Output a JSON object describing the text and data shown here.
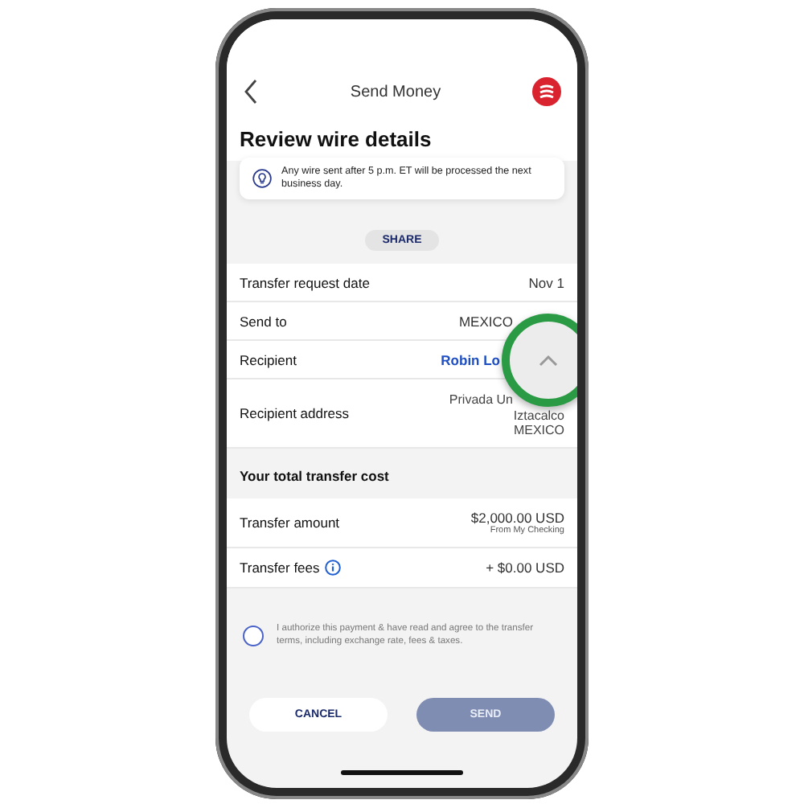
{
  "header": {
    "title": "Send Money"
  },
  "page_title": "Review wire details",
  "notice": "Any wire sent after 5 p.m. ET will be processed the next business day.",
  "share_button": "SHARE",
  "details": [
    {
      "label": "Transfer request date",
      "value": "Nov 1"
    },
    {
      "label": "Send to",
      "value": "MEXICO"
    },
    {
      "label": "Recipient",
      "value": "Robin Lo",
      "kind": "link"
    },
    {
      "label": "Recipient address",
      "lines": [
        "Privada Un",
        "Iztacalco",
        "MEXICO"
      ]
    }
  ],
  "cost_section": {
    "title": "Your total transfer cost"
  },
  "costs": [
    {
      "label": "Transfer amount",
      "value": "$2,000.00 USD",
      "note": "From My Checking",
      "info": false
    },
    {
      "label": "Transfer fees",
      "value": "+ $0.00 USD",
      "info": true
    }
  ],
  "consent": {
    "text": "I authorize this payment & have read and agree to the transfer terms, including exchange rate, fees & taxes.",
    "checked": false
  },
  "buttons": [
    {
      "label": "CANCEL",
      "disabled": false,
      "kind": "secondary"
    },
    {
      "label": "SEND",
      "disabled": true,
      "kind": "primary"
    }
  ]
}
